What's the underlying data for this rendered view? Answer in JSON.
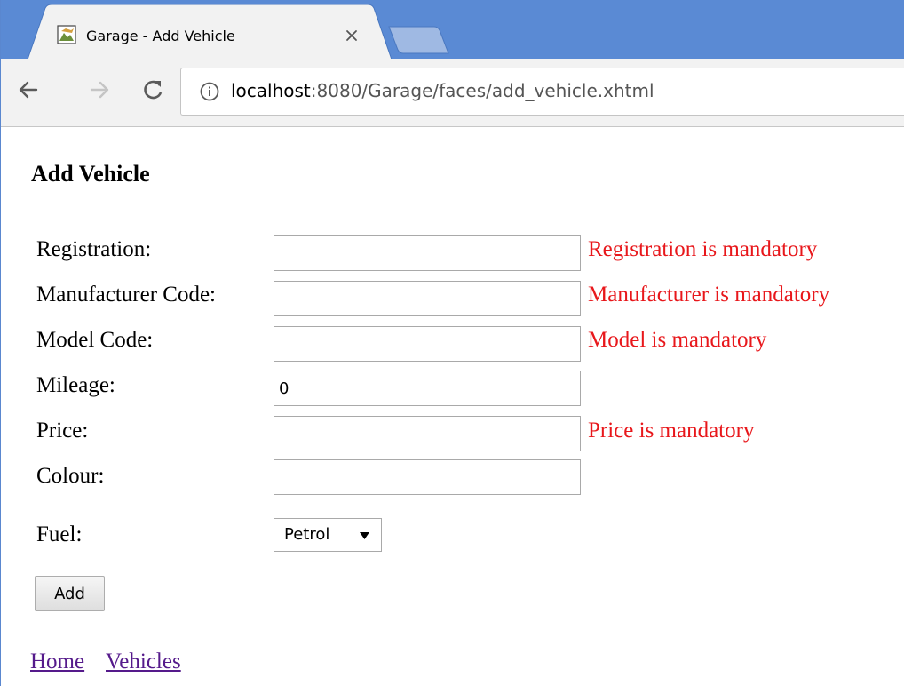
{
  "browser": {
    "tab": {
      "title": "Garage - Add Vehicle",
      "favicon": "image-icon"
    },
    "address": {
      "host": "localhost",
      "rest": ":8080/Garage/faces/add_vehicle.xhtml"
    },
    "colors": {
      "tabstrip": "#5a8ad4",
      "toolbar": "#f2f2f2"
    }
  },
  "page": {
    "title": "Add Vehicle",
    "form": {
      "registration": {
        "label": "Registration:",
        "value": "",
        "error": "Registration is mandatory"
      },
      "manufacturer": {
        "label": "Manufacturer Code:",
        "value": "",
        "error": "Manufacturer is mandatory"
      },
      "model": {
        "label": "Model Code:",
        "value": "",
        "error": "Model is mandatory"
      },
      "mileage": {
        "label": "Mileage:",
        "value": "0"
      },
      "price": {
        "label": "Price:",
        "value": "",
        "error": "Price is mandatory"
      },
      "colour": {
        "label": "Colour:",
        "value": ""
      },
      "fuel": {
        "label": "Fuel:",
        "selected": "Petrol"
      },
      "submit_label": "Add"
    },
    "links": {
      "home": "Home",
      "vehicles": "Vehicles"
    },
    "colors": {
      "error": "#e8171b",
      "link_visited": "#551a8b"
    }
  }
}
